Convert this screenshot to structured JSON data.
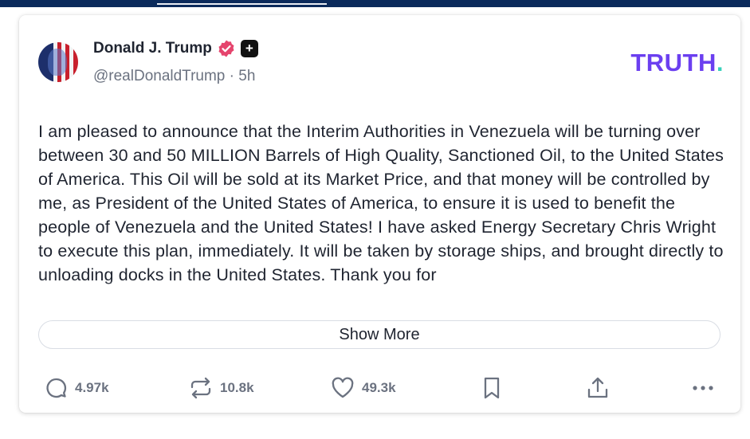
{
  "post": {
    "author_name": "Donald J. Trump",
    "handle": "@realDonaldTrump",
    "separator": " · ",
    "time_ago": "5h",
    "plus_badge": "+",
    "brand_main": "TRUTH",
    "brand_dot": ".",
    "body": "I am pleased to announce that the Interim Authorities in Venezuela will be turning over between 30 and 50 MILLION Barrels of High Quality, Sanctioned Oil, to the United States of America. This Oil will be sold at its Market Price, and that money will be controlled by me, as President of the United States of America, to ensure it is used to benefit the people of Venezuela and the United States! I have asked Energy Secretary Chris Wright to execute this plan, immediately. It will be taken by storage ships, and brought directly to unloading docks in the United States. Thank you for",
    "show_more_label": "Show More"
  },
  "actions": {
    "replies": "4.97k",
    "retruths": "10.8k",
    "likes": "49.3k"
  },
  "icons": [
    "verified-icon",
    "plus-icon",
    "reply-icon",
    "retruth-icon",
    "like-icon",
    "bookmark-icon",
    "share-icon",
    "more-icon"
  ],
  "colors": {
    "brand_purple": "#6b3ff0",
    "brand_dot": "#37d1bb",
    "verified_badge": "#e5446d",
    "top_bar": "#0b2a5b",
    "muted_text": "#6b7280"
  }
}
